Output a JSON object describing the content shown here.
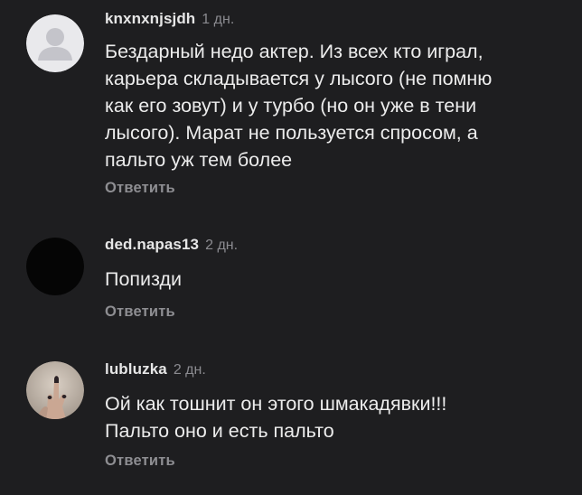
{
  "comments": [
    {
      "username": "knxnxnjsjdh",
      "time": "1 дн.",
      "avatar": "default-avatar-icon",
      "text_lines": [
        "Бездарный недо актер. Из всех кто играл,",
        "карьера складывается у лысого (не помню",
        "как его зовут) и у турбо (но он уже в тени",
        "лысого). Марат не пользуется спросом, а",
        "пальто уж тем более"
      ],
      "reply_label": "Ответить"
    },
    {
      "username": "ded.napas13",
      "time": "2 дн.",
      "avatar": "black-avatar-icon",
      "text_lines": [
        "Попизди"
      ],
      "reply_label": "Ответить"
    },
    {
      "username": "lubluzka",
      "time": "2 дн.",
      "avatar": "hand-photo-avatar",
      "text_lines": [
        "Ой как тошнит он этого шмакадявки!!!",
        "Пальто оно и есть пальто"
      ],
      "reply_label": "Ответить"
    }
  ],
  "colors": {
    "background": "#1e1e20",
    "text": "#ececec",
    "muted": "#8b8b90",
    "default_avatar_bg": "#e9e9ec",
    "default_avatar_fg": "#c4c4ca"
  }
}
